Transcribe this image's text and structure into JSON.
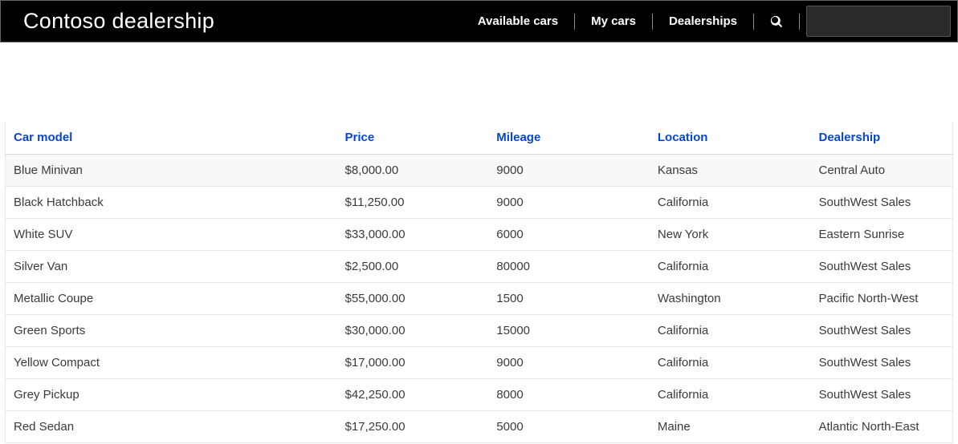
{
  "header": {
    "title": "Contoso dealership",
    "nav": {
      "available_cars": "Available cars",
      "my_cars": "My cars",
      "dealerships": "Dealerships"
    }
  },
  "table": {
    "columns": {
      "model": "Car model",
      "price": "Price",
      "mileage": "Mileage",
      "location": "Location",
      "dealership": "Dealership"
    },
    "rows": [
      {
        "model": "Blue Minivan",
        "price": "$8,000.00",
        "mileage": "9000",
        "location": "Kansas",
        "dealership": "Central Auto"
      },
      {
        "model": "Black Hatchback",
        "price": "$11,250.00",
        "mileage": "9000",
        "location": "California",
        "dealership": "SouthWest Sales"
      },
      {
        "model": "White SUV",
        "price": "$33,000.00",
        "mileage": "6000",
        "location": "New York",
        "dealership": "Eastern Sunrise"
      },
      {
        "model": "Silver Van",
        "price": "$2,500.00",
        "mileage": "80000",
        "location": "California",
        "dealership": "SouthWest Sales"
      },
      {
        "model": "Metallic Coupe",
        "price": "$55,000.00",
        "mileage": "1500",
        "location": "Washington",
        "dealership": "Pacific North-West"
      },
      {
        "model": "Green Sports",
        "price": "$30,000.00",
        "mileage": "15000",
        "location": "California",
        "dealership": "SouthWest Sales"
      },
      {
        "model": "Yellow Compact",
        "price": "$17,000.00",
        "mileage": "9000",
        "location": "California",
        "dealership": "SouthWest Sales"
      },
      {
        "model": "Grey Pickup",
        "price": "$42,250.00",
        "mileage": "8000",
        "location": "California",
        "dealership": "SouthWest Sales"
      },
      {
        "model": "Red Sedan",
        "price": "$17,250.00",
        "mileage": "5000",
        "location": "Maine",
        "dealership": "Atlantic North-East"
      }
    ]
  }
}
